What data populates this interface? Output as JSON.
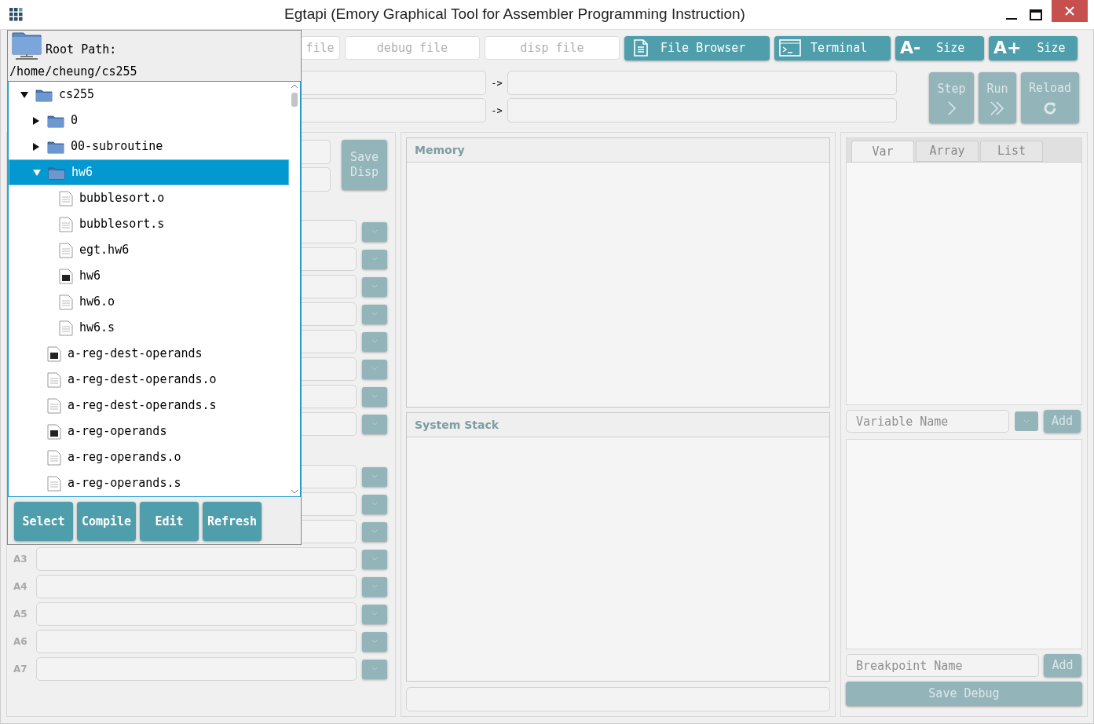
{
  "window": {
    "title": "Egtapi (Emory Graphical Tool for Assembler Programming Instruction)"
  },
  "toolbar": {
    "fields": [
      {
        "value": "file"
      },
      {
        "value": "debug file"
      },
      {
        "value": "disp file"
      }
    ],
    "buttons": [
      {
        "label": "File Browser",
        "kind": "file"
      },
      {
        "label": "Terminal",
        "kind": "terminal"
      },
      {
        "label": "Size",
        "kind": "text",
        "prefix": "A-"
      },
      {
        "label": "Size",
        "kind": "text",
        "prefix": "A+"
      }
    ]
  },
  "mappings": [
    {
      "arrow": "->"
    },
    {
      "arrow": "->"
    }
  ],
  "run_controls": [
    {
      "label": "Step",
      "kind": "chevron",
      "disabled": true
    },
    {
      "label": "Run",
      "kind": "double-chevron",
      "disabled": true
    },
    {
      "label": "Reload",
      "kind": "reload",
      "disabled": true
    }
  ],
  "display": {
    "save_button": {
      "label": "Save Disp",
      "disabled": true
    }
  },
  "register_groups": [
    {
      "rows": [
        {},
        {},
        {},
        {},
        {},
        {},
        {},
        {}
      ]
    },
    {
      "rows": [
        {},
        {},
        {},
        {
          "label": "A3"
        },
        {
          "label": "A4"
        },
        {
          "label": "A5"
        },
        {
          "label": "A6"
        },
        {
          "label": "A7"
        }
      ]
    }
  ],
  "memory": {
    "title": "Memory"
  },
  "system_stack": {
    "title": "System Stack"
  },
  "watch": {
    "tabs": [
      {
        "label": "Var",
        "selected": true
      },
      {
        "label": "Array",
        "selected": false
      },
      {
        "label": "List",
        "selected": false
      }
    ],
    "variable_placeholder": "Variable Name",
    "variable_add": "Add",
    "breakpoint_placeholder": "Breakpoint Name",
    "breakpoint_add": "Add",
    "save_button": {
      "label": "Save Debug",
      "disabled": true
    }
  },
  "file_browser": {
    "root_label": "Root Path:",
    "path": "/home/cheung/cs255",
    "tree": [
      {
        "name": "cs255",
        "kind": "folder",
        "expanded": true,
        "selected": false,
        "children": [
          {
            "name": "0",
            "kind": "folder",
            "expanded": false,
            "selected": false
          },
          {
            "name": "00-subroutine",
            "kind": "folder",
            "expanded": false,
            "selected": false
          },
          {
            "name": "hw6",
            "kind": "folder",
            "expanded": true,
            "selected": true,
            "children": [
              {
                "name": "bubblesort.o",
                "kind": "text",
                "selected": false
              },
              {
                "name": "bubblesort.s",
                "kind": "text",
                "selected": false
              },
              {
                "name": "egt.hw6",
                "kind": "text",
                "selected": false
              },
              {
                "name": "hw6",
                "kind": "exec",
                "selected": false
              },
              {
                "name": "hw6.o",
                "kind": "text",
                "selected": false
              },
              {
                "name": "hw6.s",
                "kind": "text",
                "selected": false
              }
            ]
          },
          {
            "name": "a-reg-dest-operands",
            "kind": "exec",
            "selected": false
          },
          {
            "name": "a-reg-dest-operands.o",
            "kind": "text",
            "selected": false
          },
          {
            "name": "a-reg-dest-operands.s",
            "kind": "text",
            "selected": false
          },
          {
            "name": "a-reg-operands",
            "kind": "exec",
            "selected": false
          },
          {
            "name": "a-reg-operands.o",
            "kind": "text",
            "selected": false
          },
          {
            "name": "a-reg-operands.s",
            "kind": "text",
            "selected": false
          }
        ]
      }
    ],
    "buttons": [
      "Select",
      "Compile",
      "Edit",
      "Refresh"
    ]
  }
}
